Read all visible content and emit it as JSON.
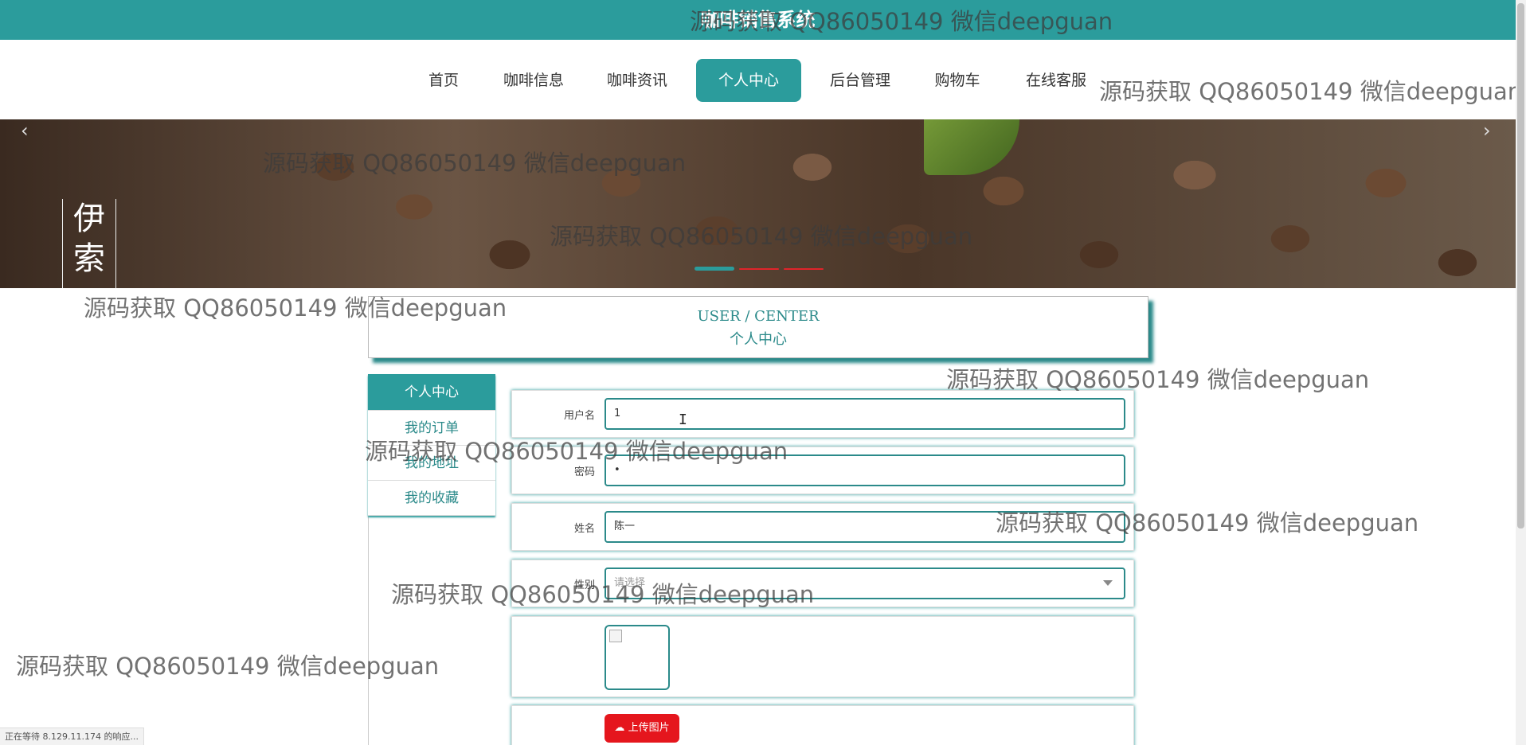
{
  "app": {
    "title": "咖啡销售系统"
  },
  "nav": {
    "items": [
      {
        "label": "首页"
      },
      {
        "label": "咖啡信息"
      },
      {
        "label": "咖啡资讯"
      },
      {
        "label": "个人中心"
      },
      {
        "label": "后台管理"
      },
      {
        "label": "购物车"
      },
      {
        "label": "在线客服"
      }
    ],
    "active_index": 3
  },
  "banner": {
    "side_text": "伊索",
    "prev_glyph": "‹",
    "next_glyph": "›",
    "slide_count": 3,
    "active_slide": 0,
    "colors": {
      "active_dot": "#2b9c9c",
      "inactive_dot": "#e0242a"
    }
  },
  "panel": {
    "title_en": "USER / CENTER",
    "title_cn": "个人中心"
  },
  "sidebar": {
    "items": [
      {
        "label": "个人中心"
      },
      {
        "label": "我的订单"
      },
      {
        "label": "我的地址"
      },
      {
        "label": "我的收藏"
      }
    ],
    "active_index": 0
  },
  "form": {
    "username": {
      "label": "用户名",
      "value": "1"
    },
    "password": {
      "label": "密码",
      "value": "•"
    },
    "name": {
      "label": "姓名",
      "value": "陈一"
    },
    "gender": {
      "label": "性别",
      "placeholder": "请选择"
    },
    "avatar": {
      "icon": "broken-image-icon"
    },
    "upload": {
      "label": "上传图片",
      "icon": "cloud-upload-icon"
    }
  },
  "statusbar": {
    "text": "正在等待 8.129.11.174 的响应..."
  },
  "watermark": {
    "text": "源码获取 QQ86050149 微信deepguan"
  },
  "theme": {
    "accent": "#2b9c9c",
    "upload_red": "#e5161d"
  }
}
